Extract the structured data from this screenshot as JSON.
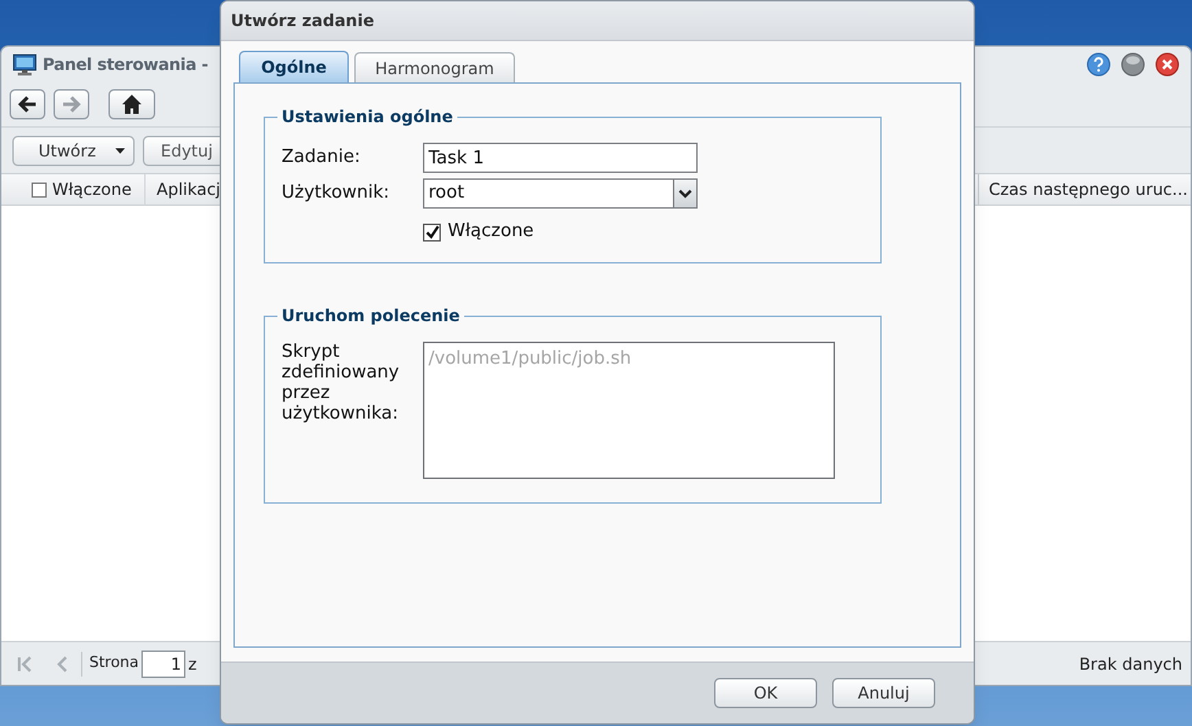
{
  "background_window": {
    "title": "Panel sterowania -",
    "nav_buttons": [
      {
        "kind": "back",
        "disabled": false
      },
      {
        "kind": "forward",
        "disabled": true
      },
      {
        "kind": "home",
        "disabled": false
      }
    ],
    "actions": [
      {
        "label": "Utwórz",
        "kind": "dropdown"
      },
      {
        "label": "Edytuj",
        "kind": "plain"
      }
    ],
    "columns": [
      {
        "label": "Włączone",
        "kind": "checkbox",
        "checked": false
      },
      {
        "label": "Aplikacj",
        "kind": "text"
      },
      {
        "label": "Czas następnego uruc...",
        "kind": "text"
      }
    ],
    "pager": {
      "page_label": "Strona",
      "page": "1",
      "of_label": "z",
      "status": "Brak danych"
    }
  },
  "dialog": {
    "title": "Utwórz zadanie",
    "tabs": [
      {
        "label": "Ogólne",
        "selected": true
      },
      {
        "label": "Harmonogram",
        "selected": false
      }
    ],
    "general": {
      "legend": "Ustawienia ogólne",
      "task_label": "Zadanie:",
      "task_value": "Task 1",
      "user_label": "Użytkownik:",
      "user_value": "root",
      "enabled": {
        "label": "Włączone",
        "checked": true
      }
    },
    "command": {
      "legend": "Uruchom polecenie",
      "script_label": "Skrypt zdefiniowany przez użytkownika:",
      "script_placeholder": "/volume1/public/job.sh"
    },
    "buttons": [
      {
        "label": "OK"
      },
      {
        "label": "Anuluj"
      }
    ]
  }
}
